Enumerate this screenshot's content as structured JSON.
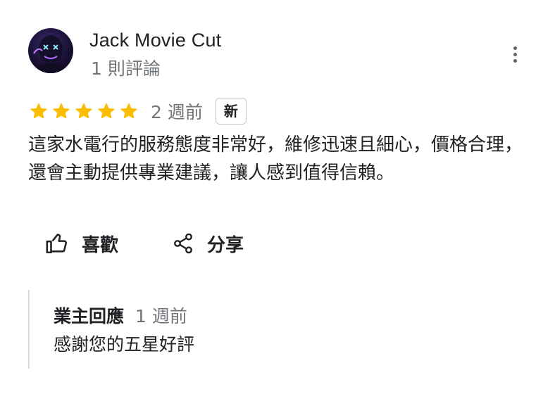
{
  "reviewer": {
    "name": "Jack Movie Cut",
    "review_count": "1 則評論",
    "avatar_icon": "purge-mask-avatar"
  },
  "review": {
    "rating": 5,
    "max_rating": 5,
    "time_ago": "2 週前",
    "badge": "新",
    "text": "這家水電行的服務態度非常好，維修迅速且細心，價格合理，還會主動提供專業建議，讓人感到值得信賴。",
    "star_color": "#fbbc04"
  },
  "actions": {
    "like_label": "喜歡",
    "like_icon": "thumbs-up-icon",
    "share_label": "分享",
    "share_icon": "share-icon",
    "more_icon": "more-vert-icon"
  },
  "owner_reply": {
    "author": "業主回應",
    "time_ago": "1 週前",
    "text": "感謝您的五星好評"
  }
}
